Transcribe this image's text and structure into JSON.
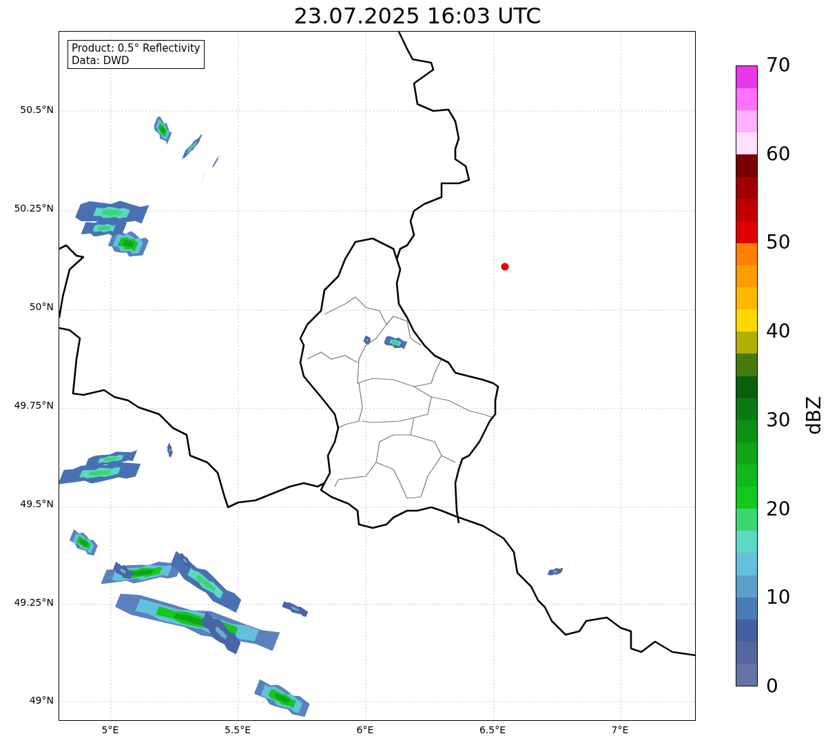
{
  "title": "23.07.2025 16:03 UTC",
  "info_box": {
    "lines": [
      "Product: 0.5° Reflectivity",
      "Data: DWD"
    ]
  },
  "map": {
    "lat_labels": [
      "50.5°N",
      "50.25°N",
      "50°N",
      "49.75°N",
      "49.5°N",
      "49.25°N",
      "49°N"
    ],
    "lon_labels": [
      "5°E",
      "5.5°E",
      "6°E",
      "6.5°E",
      "7°E"
    ]
  },
  "colorbar": {
    "label": "dBZ",
    "ticks": [
      "70",
      "60",
      "50",
      "40",
      "30",
      "20",
      "10",
      "0"
    ],
    "bands": [
      {
        "color": "#e838e8"
      },
      {
        "color": "#ff70ff"
      },
      {
        "color": "#ffb0ff"
      },
      {
        "color": "#ffe0ff"
      },
      {
        "color": "#780000"
      },
      {
        "color": "#a00000"
      },
      {
        "color": "#c00000"
      },
      {
        "color": "#e00000"
      },
      {
        "color": "#ff8000"
      },
      {
        "color": "#ff9c00"
      },
      {
        "color": "#ffb800"
      },
      {
        "color": "#ffd800"
      },
      {
        "color": "#b0b000"
      },
      {
        "color": "#467a0c"
      },
      {
        "color": "#08600c"
      },
      {
        "color": "#0a7a12"
      },
      {
        "color": "#0c9014"
      },
      {
        "color": "#10a418"
      },
      {
        "color": "#10b81c"
      },
      {
        "color": "#14c81c"
      },
      {
        "color": "#3cd670"
      },
      {
        "color": "#5cd8c4"
      },
      {
        "color": "#64c0dc"
      },
      {
        "color": "#5aa0c8"
      },
      {
        "color": "#4a7cb4"
      },
      {
        "color": "#4460a0"
      },
      {
        "color": "#5467a0"
      },
      {
        "color": "#6474a8"
      }
    ]
  }
}
